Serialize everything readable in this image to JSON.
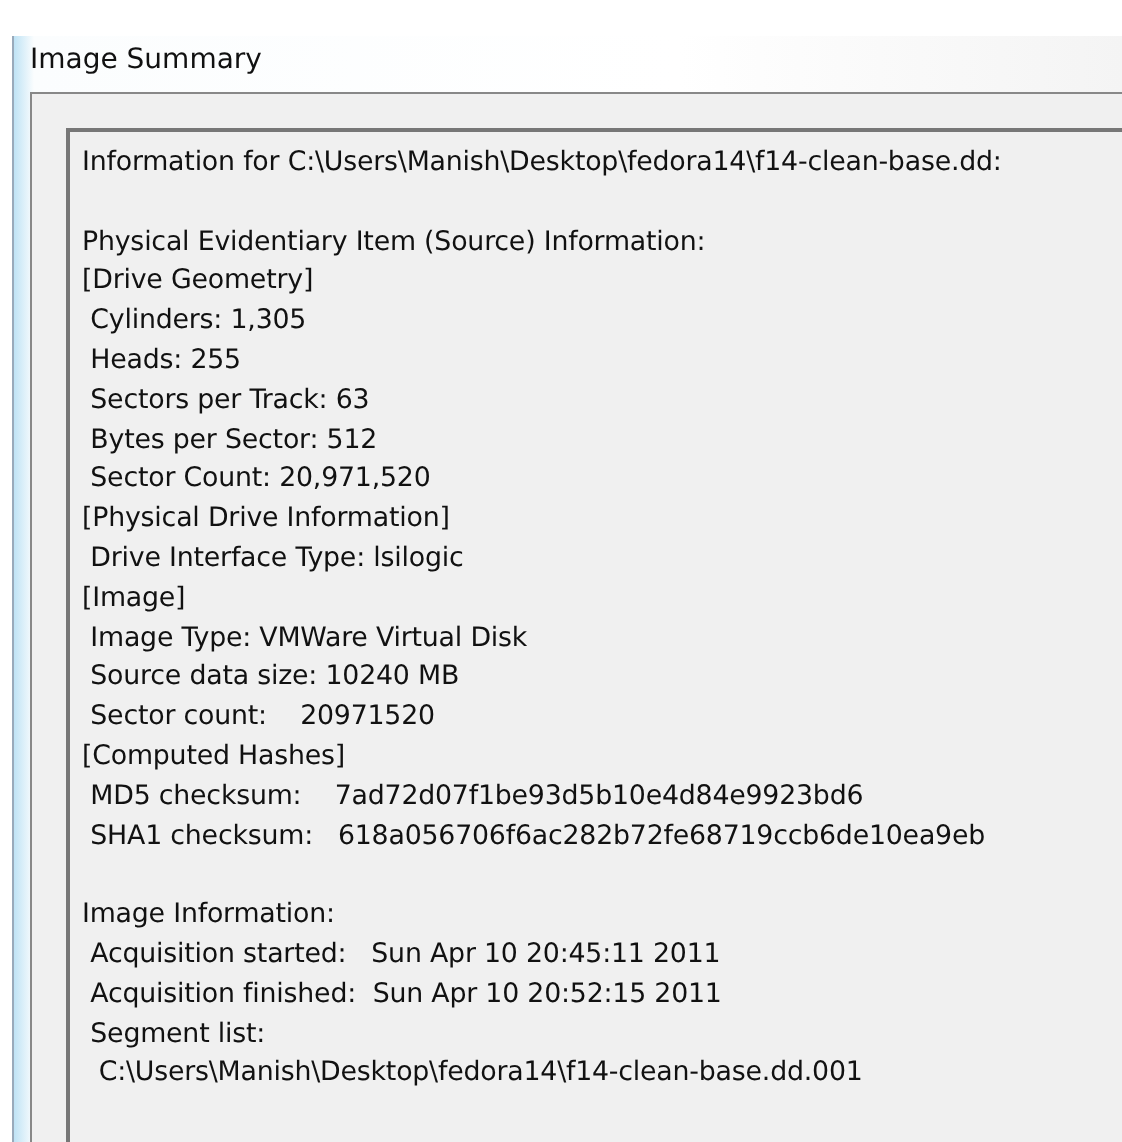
{
  "window": {
    "title": "Image Summary"
  },
  "summary": {
    "sections": [
      {
        "lines": [
          "Information for C:\\Users\\Manish\\Desktop\\fedora14\\f14-clean-base.dd:"
        ]
      },
      {
        "lines": [
          "Physical Evidentiary Item (Source) Information:",
          "[Drive Geometry]",
          " Cylinders: 1,305",
          " Heads: 255",
          " Sectors per Track: 63",
          " Bytes per Sector: 512",
          " Sector Count: 20,971,520",
          "[Physical Drive Information]",
          " Drive Interface Type: lsilogic",
          "[Image]",
          " Image Type: VMWare Virtual Disk",
          " Source data size: 10240 MB",
          " Sector count:    20971520",
          "[Computed Hashes]",
          " MD5 checksum:    7ad72d07f1be93d5b10e4d84e9923bd6",
          " SHA1 checksum:   618a056706f6ac282b72fe68719ccb6de10ea9eb"
        ]
      },
      {
        "lines": [
          "Image Information:",
          " Acquisition started:   Sun Apr 10 20:45:11 2011",
          " Acquisition finished:  Sun Apr 10 20:52:15 2011",
          " Segment list:",
          "  C:\\Users\\Manish\\Desktop\\fedora14\\f14-clean-base.dd.001"
        ]
      }
    ]
  }
}
